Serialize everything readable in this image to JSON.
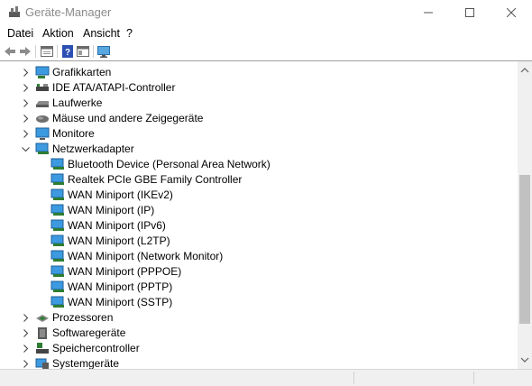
{
  "window": {
    "title": "Geräte-Manager",
    "icon": "device-manager-icon",
    "controls": [
      "minimize-icon",
      "maximize-icon",
      "close-icon"
    ]
  },
  "menu": [
    {
      "label": "Datei"
    },
    {
      "label": "Aktion"
    },
    {
      "label": "Ansicht"
    },
    {
      "label": "?"
    }
  ],
  "toolbar": [
    "back-arrow-icon",
    "forward-arrow-icon",
    "properties-icon",
    "help-icon",
    "view-icon",
    "monitor-icon"
  ],
  "tree": [
    {
      "label": "Grafikkarten",
      "icon": "display-adapter-icon",
      "expanded": false
    },
    {
      "label": "IDE ATA/ATAPI-Controller",
      "icon": "ide-controller-icon",
      "expanded": false
    },
    {
      "label": "Laufwerke",
      "icon": "disk-drive-icon",
      "expanded": false
    },
    {
      "label": "Mäuse und andere Zeigegeräte",
      "icon": "mouse-icon",
      "expanded": false
    },
    {
      "label": "Monitore",
      "icon": "monitor-icon",
      "expanded": false
    },
    {
      "label": "Netzwerkadapter",
      "icon": "network-adapter-icon",
      "expanded": true,
      "children": [
        {
          "label": "Bluetooth Device (Personal Area Network)"
        },
        {
          "label": "Realtek PCIe GBE Family Controller"
        },
        {
          "label": "WAN Miniport (IKEv2)"
        },
        {
          "label": "WAN Miniport (IP)"
        },
        {
          "label": "WAN Miniport (IPv6)"
        },
        {
          "label": "WAN Miniport (L2TP)"
        },
        {
          "label": "WAN Miniport (Network Monitor)"
        },
        {
          "label": "WAN Miniport (PPPOE)"
        },
        {
          "label": "WAN Miniport (PPTP)"
        },
        {
          "label": "WAN Miniport (SSTP)"
        }
      ]
    },
    {
      "label": "Prozessoren",
      "icon": "processor-icon",
      "expanded": false
    },
    {
      "label": "Softwaregeräte",
      "icon": "software-device-icon",
      "expanded": false
    },
    {
      "label": "Speichercontroller",
      "icon": "storage-controller-icon",
      "expanded": false
    },
    {
      "label": "Systemgeräte",
      "icon": "system-device-icon",
      "expanded": false
    }
  ],
  "colors": {
    "adapter": "#3d9ae0",
    "accent": "#1e73c7"
  }
}
